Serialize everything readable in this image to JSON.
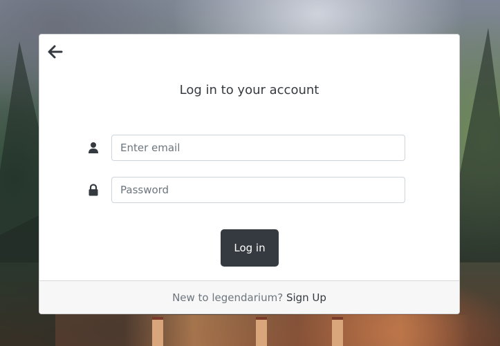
{
  "login": {
    "title": "Log in to your account",
    "email": {
      "placeholder": "Enter email",
      "value": "",
      "icon": "user-icon"
    },
    "password": {
      "placeholder": "Password",
      "value": "",
      "icon": "lock-icon"
    },
    "submit_label": "Log in",
    "back_icon": "arrow-left-icon"
  },
  "footer": {
    "prompt": "New to legendarium?",
    "signup_label": "Sign Up"
  },
  "colors": {
    "button_bg": "#343a40",
    "footer_bg": "#f7f7f7",
    "card_bg": "#ffffff"
  }
}
